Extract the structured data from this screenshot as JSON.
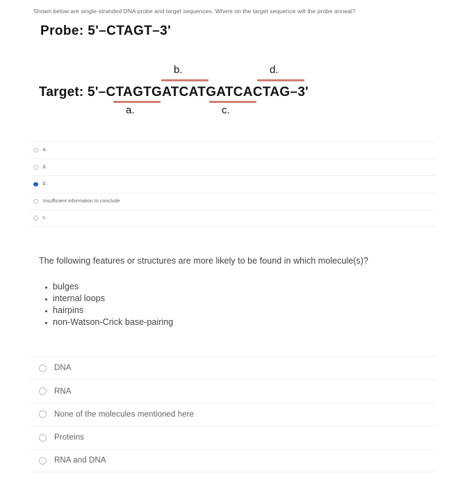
{
  "question1": {
    "prompt": "Shown below are single-stranded DNA probe and target sequences.  Where on the target sequence will the probe anneal?",
    "probe_label": "Probe:",
    "probe_sequence": "5'–CTAGT–3'",
    "target_label": "Target:",
    "target_sequence": "5'–CTAGTGATCATGATCACTAG–3'",
    "sequence_bases": "CTAGTGATCATGATCACTAG",
    "annotations": [
      {
        "id": "a",
        "label": "a.",
        "position": "below",
        "bases": "CTAGT",
        "start_index": 0,
        "end_index": 4
      },
      {
        "id": "b",
        "label": "b.",
        "position": "above",
        "bases": "GATCA",
        "start_index": 5,
        "end_index": 9
      },
      {
        "id": "c",
        "label": "c.",
        "position": "below",
        "bases": "TGATC",
        "start_index": 10,
        "end_index": 14
      },
      {
        "id": "d",
        "label": "d.",
        "position": "above",
        "bases": "ACTAG",
        "start_index": 15,
        "end_index": 19
      }
    ],
    "underline_color": "#d07f70",
    "options": [
      {
        "label": "a.",
        "selected": false
      },
      {
        "label": "d.",
        "selected": false
      },
      {
        "label": "b.",
        "selected": true
      },
      {
        "label": "Insufficient information to conclude",
        "selected": false
      },
      {
        "label": "c.",
        "selected": false
      }
    ],
    "selected_color": "#1a62c9"
  },
  "question2": {
    "prompt": "The following features or structures are more likely to be found in which molecule(s)?",
    "bullets": [
      "bulges",
      "internal loops",
      "hairpins",
      "non-Watson-Crick base-pairing"
    ],
    "options": [
      {
        "label": "DNA",
        "selected": false
      },
      {
        "label": "RNA",
        "selected": false
      },
      {
        "label": "None of the molecules mentioned here",
        "selected": false
      },
      {
        "label": "Proteins",
        "selected": false
      },
      {
        "label": "RNA and DNA",
        "selected": false
      }
    ]
  }
}
